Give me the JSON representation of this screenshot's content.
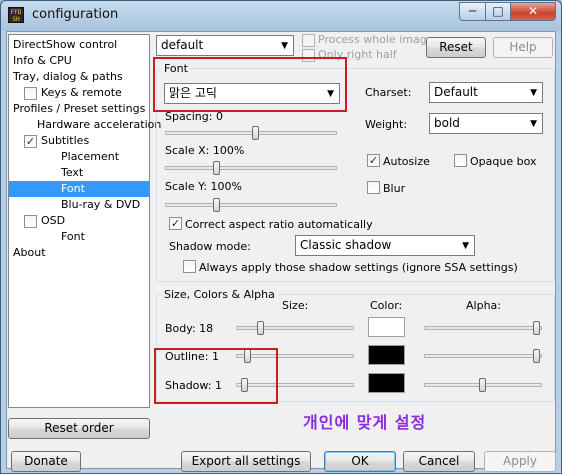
{
  "window": {
    "title": "configuration",
    "icon_text": "FFD\nSH",
    "min_glyph": "─",
    "max_glyph": "□",
    "close_glyph": "✕"
  },
  "tree": {
    "items": [
      {
        "label": "DirectShow control"
      },
      {
        "label": "Info & CPU"
      },
      {
        "label": "Tray, dialog & paths"
      },
      {
        "label": "Keys & remote",
        "checked": false
      },
      {
        "label": "Profiles / Preset settings"
      },
      {
        "label": "Hardware acceleration"
      },
      {
        "label": "Subtitles",
        "checked": true
      },
      {
        "label": "Placement"
      },
      {
        "label": "Text"
      },
      {
        "label": "Font",
        "selected": true
      },
      {
        "label": "Blu-ray & DVD"
      },
      {
        "label": "OSD",
        "checked": false
      },
      {
        "label": "Font"
      },
      {
        "label": "About"
      }
    ]
  },
  "top": {
    "preset_value": "default",
    "process_whole_image": {
      "label": "Process whole image",
      "checked": false,
      "enabled": false
    },
    "only_right_half": {
      "label": "Only right half",
      "checked": false,
      "enabled": false
    },
    "reset_label": "Reset",
    "help_label": "Help"
  },
  "font_group": {
    "title": "Font",
    "font_value": "맑은 고딕",
    "spacing_label": "Spacing: 0",
    "charset_label": "Charset:",
    "charset_value": "Default",
    "weight_label": "Weight:",
    "weight_value": "bold",
    "scale_x_label": "Scale X: 100%",
    "scale_y_label": "Scale Y: 100%",
    "autosize": {
      "label": "Autosize",
      "checked": true
    },
    "opaque_box": {
      "label": "Opaque box",
      "checked": false
    },
    "blur": {
      "label": "Blur",
      "checked": false
    },
    "correct_aspect": {
      "label": "Correct aspect ratio automatically",
      "checked": true
    },
    "shadow_mode_label": "Shadow mode:",
    "shadow_mode_value": "Classic shadow",
    "always_apply": {
      "label": "Always apply those shadow settings (ignore SSA settings)",
      "checked": false
    }
  },
  "size_group": {
    "title": "Size, Colors & Alpha",
    "col_size": "Size:",
    "col_color": "Color:",
    "col_alpha": "Alpha:",
    "body_label": "Body: 18",
    "outline_label": "Outline: 1",
    "shadow_label": "Shadow: 1",
    "body_color": "#ffffff",
    "outline_color": "#000000",
    "shadow_color": "#000000"
  },
  "overlay_note": "개인에 맞게 설정",
  "bottom": {
    "reset_order_label": "Reset order",
    "donate_label": "Donate",
    "export_label": "Export all settings",
    "ok_label": "OK",
    "cancel_label": "Cancel",
    "apply_label": "Apply"
  },
  "colors": {
    "selection": "#3399ff",
    "highlight_box": "#c81e1e",
    "overlay_text": "#8a2be2"
  }
}
